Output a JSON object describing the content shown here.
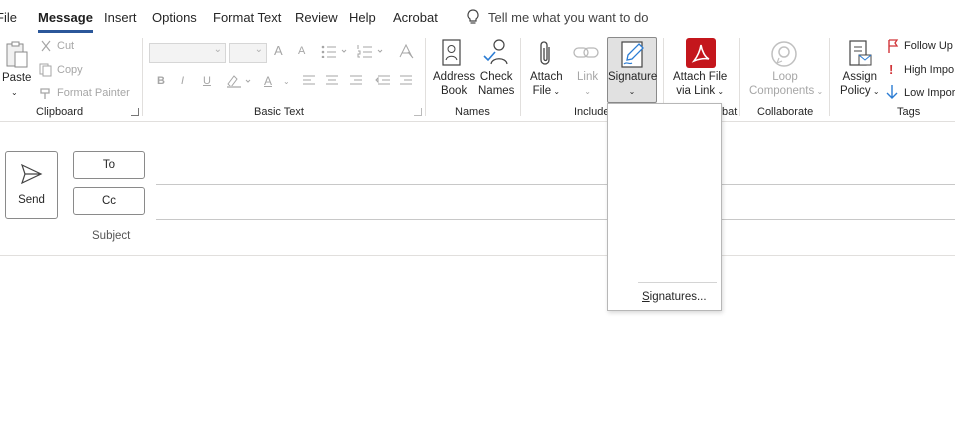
{
  "tabs": {
    "file": "File",
    "message": "Message",
    "insert": "Insert",
    "options": "Options",
    "format_text": "Format Text",
    "review": "Review",
    "help": "Help",
    "acrobat": "Acrobat"
  },
  "tell_me": "Tell me what you want to do",
  "ribbon": {
    "clipboard": {
      "paste": "Paste",
      "cut": "Cut",
      "copy": "Copy",
      "format_painter": "Format Painter",
      "label": "Clipboard"
    },
    "basic_text": {
      "bold": "B",
      "italic": "I",
      "underline": "U",
      "grow_font": "A",
      "shrink_font": "A",
      "font_color": "A",
      "label": "Basic Text"
    },
    "names": {
      "address_book_1": "Address",
      "address_book_2": "Book",
      "check_names_1": "Check",
      "check_names_2": "Names",
      "label": "Names"
    },
    "include": {
      "attach_file_1": "Attach",
      "attach_file_2": "File",
      "link": "Link",
      "signature": "Signature",
      "label": "Include"
    },
    "adobe_acrobat": {
      "attach_via_link_1": "Attach File",
      "attach_via_link_2": "via Link",
      "label": "bat"
    },
    "collaborate": {
      "loop_1": "Loop",
      "loop_2": "Components",
      "label": "Collaborate"
    },
    "tags": {
      "assign_policy_1": "Assign",
      "assign_policy_2": "Policy",
      "follow_up": "Follow Up",
      "high_importance": "High Impo",
      "low_importance": "Low Impor",
      "label": "Tags"
    }
  },
  "compose": {
    "send": "Send",
    "to": "To",
    "cc": "Cc",
    "subject": "Subject"
  },
  "signature_menu": {
    "signatures_item": "Signatures...",
    "mnemonic": "S",
    "rest": "ignatures..."
  },
  "colors": {
    "accent": "#2b579a",
    "acrobat_red": "#c4161c",
    "follow_up_red": "#d13438",
    "low_importance_blue": "#2b7cd3"
  }
}
